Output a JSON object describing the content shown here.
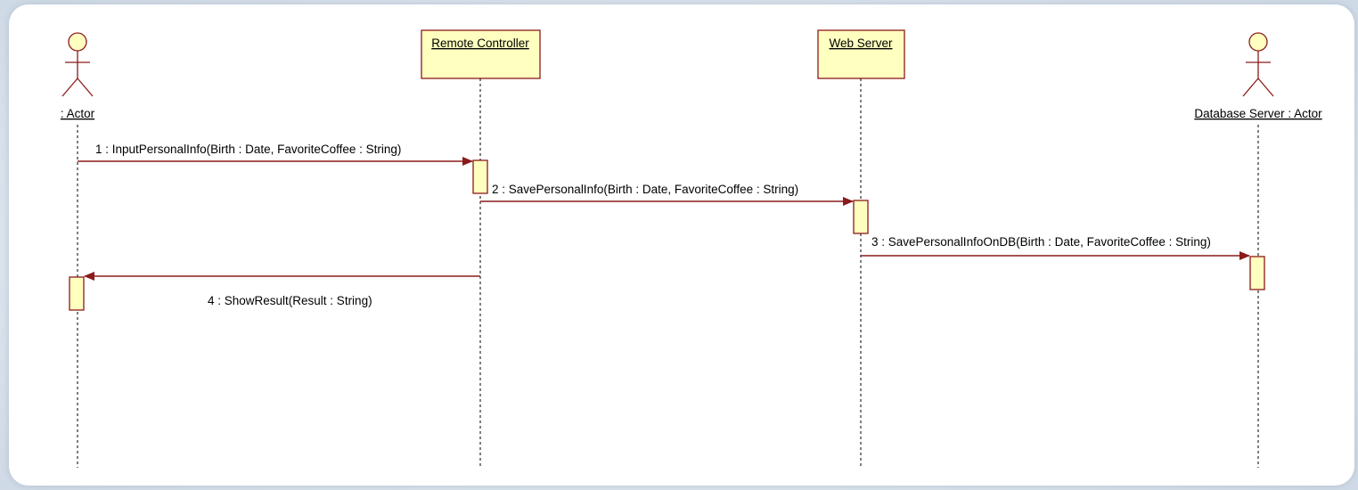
{
  "diagram": {
    "type": "sequence",
    "colors": {
      "box_fill": "#ffffc0",
      "line": "#8b1a1a",
      "lifeline": "#000000"
    },
    "participants": [
      {
        "id": "actor",
        "label": ": Actor",
        "kind": "actor"
      },
      {
        "id": "remote",
        "label": "Remote Controller",
        "kind": "object"
      },
      {
        "id": "web",
        "label": "Web Server",
        "kind": "object"
      },
      {
        "id": "db",
        "label": "Database Server : Actor",
        "kind": "actor"
      }
    ],
    "messages": [
      {
        "from": "actor",
        "to": "remote",
        "label": "1 : InputPersonalInfo(Birth : Date, FavoriteCoffee : String)"
      },
      {
        "from": "remote",
        "to": "web",
        "label": "2 : SavePersonalInfo(Birth : Date, FavoriteCoffee : String)"
      },
      {
        "from": "web",
        "to": "db",
        "label": "3 : SavePersonalInfoOnDB(Birth : Date, FavoriteCoffee : String)"
      },
      {
        "from": "remote",
        "to": "actor",
        "label": "4 : ShowResult(Result : String)"
      }
    ]
  }
}
